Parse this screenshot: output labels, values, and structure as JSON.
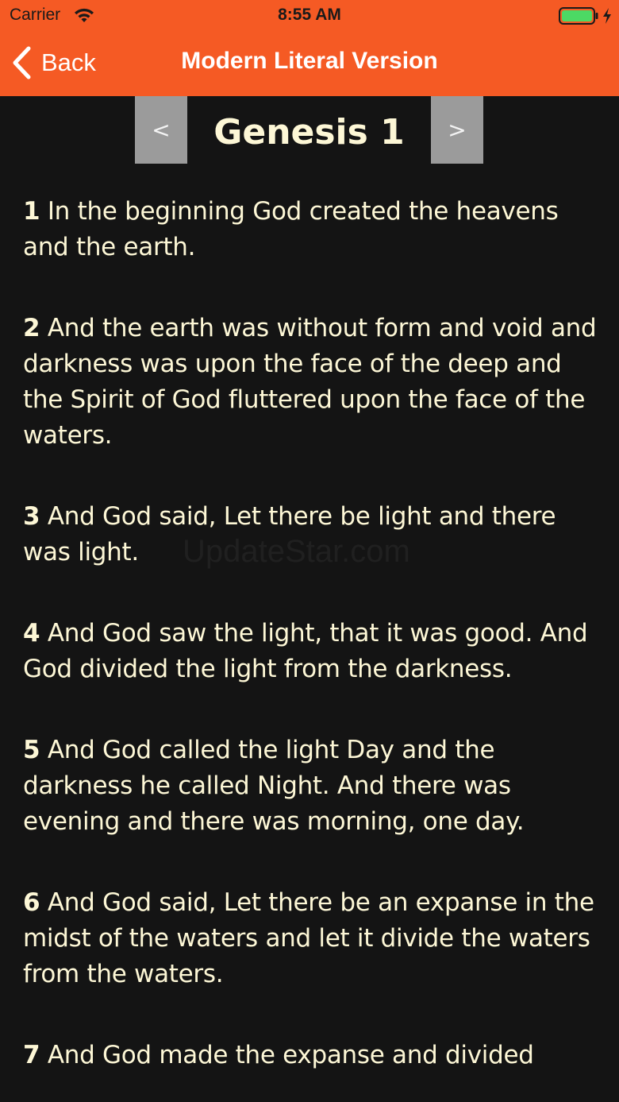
{
  "status_bar": {
    "carrier": "Carrier",
    "time": "8:55 AM",
    "battery_color": "#4cd964"
  },
  "nav": {
    "back_label": "Back",
    "title": "Modern Literal Version",
    "bar_color": "#f55a24"
  },
  "chapter": {
    "prev_label": "<",
    "title": "Genesis 1",
    "next_label": ">"
  },
  "verses": [
    {
      "number": "1",
      "text": "In the beginning God created the heavens and the earth."
    },
    {
      "number": "2",
      "text": "And the earth was without form and void and darkness was upon the face of the deep and the Spirit of God fluttered upon the face of the waters."
    },
    {
      "number": "3",
      "text": "And God said, Let there be light and there was light."
    },
    {
      "number": "4",
      "text": "And God saw the light, that it was good. And God divided the light from the darkness."
    },
    {
      "number": "5",
      "text": "And God called the light Day and the darkness he called Night. And there was evening and there was morning, one day."
    },
    {
      "number": "6",
      "text": "And God said, Let there be an expanse in the midst of the waters and let it divide the waters from the waters."
    },
    {
      "number": "7",
      "text": "And God made the expanse and divided"
    }
  ],
  "watermark": "UpdateStar.com"
}
